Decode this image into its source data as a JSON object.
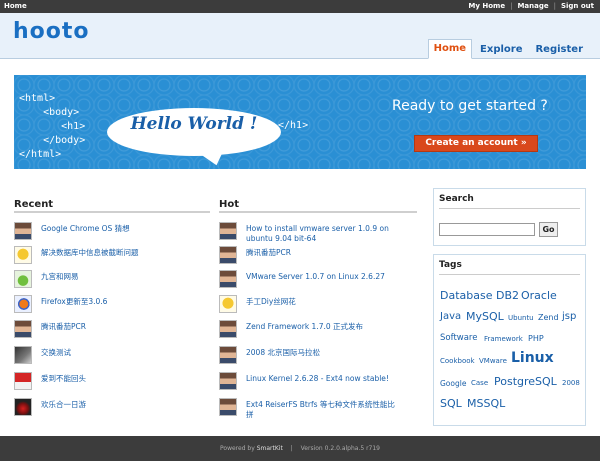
{
  "topbar": {
    "home": "Home",
    "my_home": "My Home",
    "manage": "Manage",
    "sign_out": "Sign out",
    "sep": "|"
  },
  "header": {
    "logo": "hooto",
    "nav": [
      "Home",
      "Explore",
      "Register"
    ]
  },
  "banner": {
    "code_lines": "<html>\n    <body>\n       <h1>\n    </body>\n</html>",
    "bubble": "Hello World !",
    "close_tag": "</h1>",
    "ready": "Ready to get started ?",
    "cta": "Create an account »"
  },
  "recent": {
    "title": "Recent",
    "items": [
      "Google Chrome OS 猜想",
      "解决数据库中信息被截断问题",
      "九宫和网易",
      "Firefox更新至3.0.6",
      "腾讯番茄PCR",
      "交换测试",
      "爱到不能回头",
      "欢乐合一日游"
    ]
  },
  "hot": {
    "title": "Hot",
    "items": [
      "How to install vmware server 1.0.9 on\nubuntu 9.04 bit-64",
      "腾讯番茄PCR",
      "VMware Server 1.0.7 on Linux 2.6.27",
      "手工Diy丝网花",
      "Zend Framework 1.7.0 正式发布",
      "2008 北京国际马拉松",
      "Linux Kernel 2.6.28 - Ext4 now stable!",
      "Ext4 ReiserFS Btrfs 等七种文件系统性能比\n拼"
    ]
  },
  "search": {
    "title": "Search",
    "value": "",
    "go": "Go"
  },
  "tags": {
    "title": "Tags",
    "items": [
      "Database",
      "DB2",
      "Oracle",
      "Java",
      "MySQL",
      "Ubuntu",
      "Zend",
      "jsp",
      "Software",
      "Framework",
      "PHP",
      "Cookbook",
      "VMware",
      "Linux",
      "Google",
      "Case",
      "PostgreSQL",
      "2008",
      "SQL",
      "MSSQL"
    ]
  },
  "footer": {
    "powered": "Powered by ",
    "brand": "SmartKit",
    "version": "Version 0.2.0.alpha.5 r719",
    "sep": "|"
  }
}
